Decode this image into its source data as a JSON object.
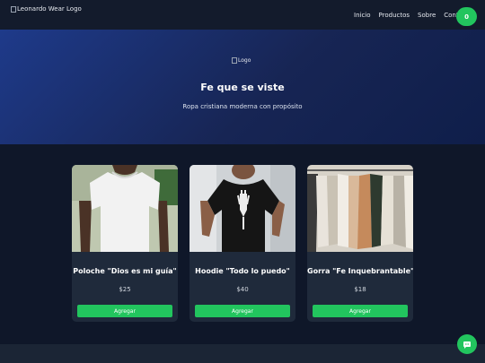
{
  "header": {
    "logo_alt": "Leonardo Wear Logo",
    "nav": [
      "Inicio",
      "Productos",
      "Sobre",
      "Contacto"
    ],
    "cart_count": "0"
  },
  "hero": {
    "logo_alt": "Logo",
    "title": "Fe que se viste",
    "subtitle": "Ropa cristiana moderna con propósito"
  },
  "products": [
    {
      "name": "Poloche \"Dios es mi guía\"",
      "price": "$25",
      "button": "Agregar",
      "image": "white-tshirt-photo"
    },
    {
      "name": "Hoodie \"Todo lo puedo\"",
      "price": "$40",
      "button": "Agregar",
      "image": "black-graphic-tshirt-photo"
    },
    {
      "name": "Gorra \"Fe Inquebrantable\"",
      "price": "$18",
      "button": "Agregar",
      "image": "clothing-rack-photo"
    }
  ],
  "colors": {
    "accent": "#22c55e",
    "background": "#0f1729",
    "card": "#1f2a3b",
    "hero": "#1e3a8a"
  },
  "chat": {
    "icon": "chat-icon"
  }
}
